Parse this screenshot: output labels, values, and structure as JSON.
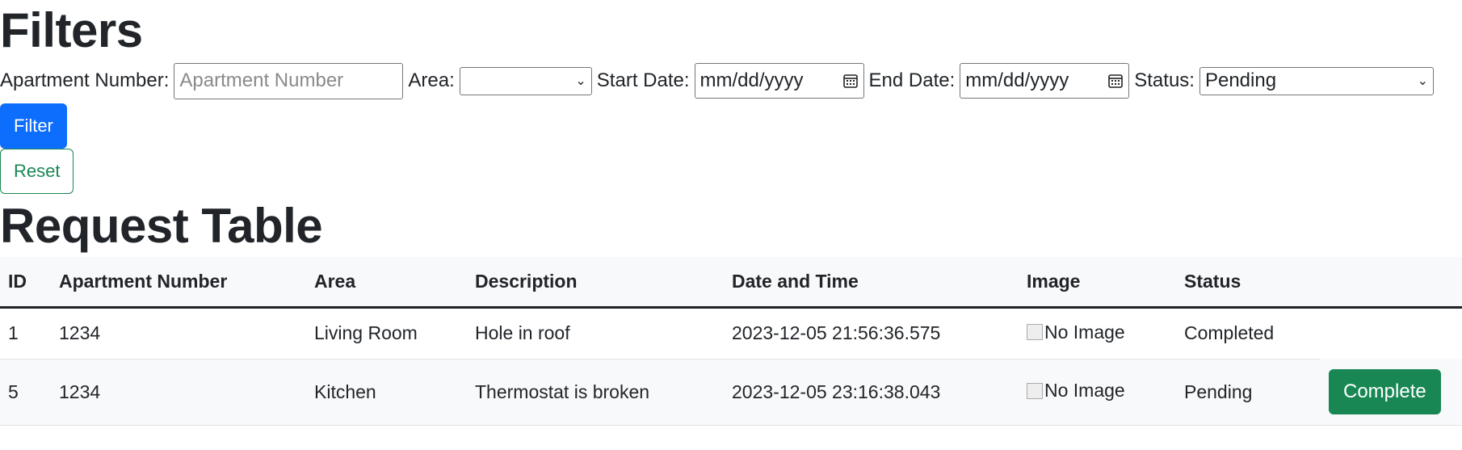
{
  "filters": {
    "title": "Filters",
    "apartment_label": "Apartment Number:",
    "apartment_placeholder": "Apartment Number",
    "apartment_value": "",
    "area_label": "Area:",
    "area_value": "",
    "start_label": "Start Date:",
    "start_value": "mm/dd/yyyy",
    "end_label": "End Date:",
    "end_value": "mm/dd/yyyy",
    "status_label": "Status:",
    "status_value": "Pending",
    "filter_button": "Filter",
    "reset_button": "Reset"
  },
  "table": {
    "title": "Request Table",
    "headers": {
      "id": "ID",
      "apartment": "Apartment Number",
      "area": "Area",
      "description": "Description",
      "datetime": "Date and Time",
      "image": "Image",
      "status": "Status"
    },
    "rows": [
      {
        "id": "1",
        "apartment": "1234",
        "area": "Living Room",
        "description": "Hole in roof",
        "datetime": "2023-12-05 21:56:36.575",
        "image_alt": "No Image",
        "status": "Completed",
        "action": ""
      },
      {
        "id": "5",
        "apartment": "1234",
        "area": "Kitchen",
        "description": "Thermostat is broken",
        "datetime": "2023-12-05 23:16:38.043",
        "image_alt": "No Image",
        "status": "Pending",
        "action": "Complete"
      }
    ]
  },
  "icons": {
    "select_chevron": "chevron-down-icon",
    "date_picker": "calendar-icon",
    "image": "broken-image-icon"
  },
  "colors": {
    "primary": "#0d6efd",
    "success": "#198754",
    "text": "#212529",
    "header_bg": "#f8f9fa"
  }
}
